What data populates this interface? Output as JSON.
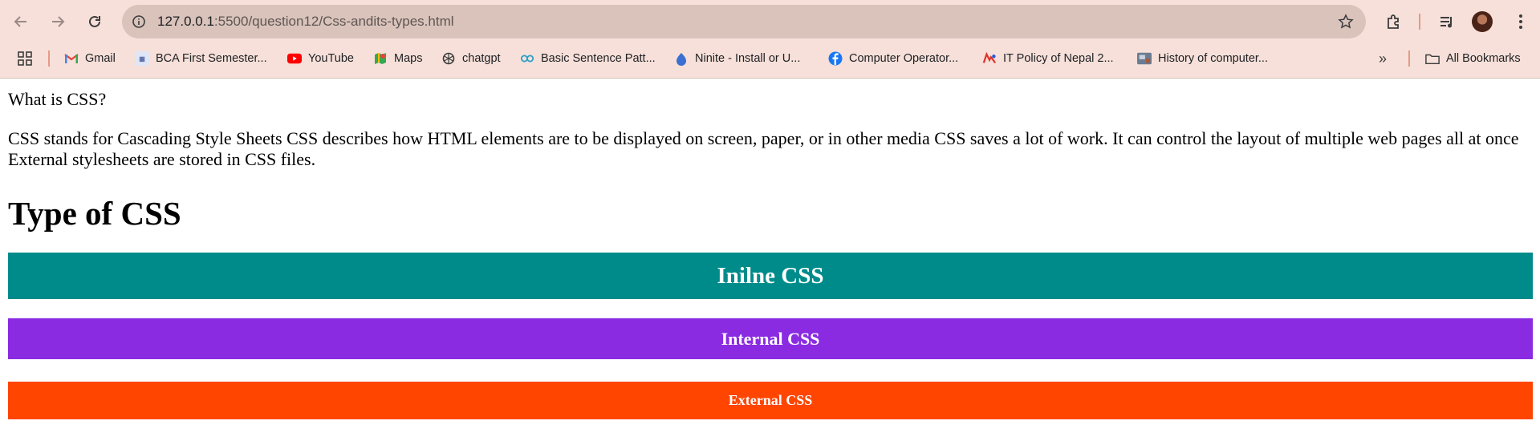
{
  "browser": {
    "url_host": "127.0.0.1",
    "url_path": ":5500/question12/Css-andits-types.html",
    "bookmarks": [
      {
        "label": "Gmail",
        "icon": "gmail-icon"
      },
      {
        "label": "BCA First Semester...",
        "icon": "bca-icon"
      },
      {
        "label": "YouTube",
        "icon": "youtube-icon"
      },
      {
        "label": "Maps",
        "icon": "maps-icon"
      },
      {
        "label": "chatgpt",
        "icon": "chatgpt-icon"
      },
      {
        "label": "Basic Sentence Patt...",
        "icon": "infinity-icon"
      },
      {
        "label": "Ninite - Install or U...",
        "icon": "ninite-icon"
      },
      {
        "label": "Computer Operator...",
        "icon": "facebook-icon"
      },
      {
        "label": "IT Policy of Nepal 2...",
        "icon": "itpolicy-icon"
      },
      {
        "label": "History of computer...",
        "icon": "history-icon"
      }
    ],
    "all_bookmarks_label": "All Bookmarks"
  },
  "page": {
    "question": "What is CSS?",
    "paragraph": "CSS stands for Cascading Style Sheets CSS describes how HTML elements are to be displayed on screen, paper, or in other media CSS saves a lot of work. It can control the layout of multiple web pages all at once External stylesheets are stored in CSS files.",
    "heading": "Type of CSS",
    "types": {
      "inline": "Inilne CSS",
      "internal": "Internal CSS",
      "external": "External CSS"
    }
  },
  "colors": {
    "inline_bg": "#008b8b",
    "internal_bg": "#8a2be2",
    "external_bg": "#ff4500",
    "chrome_bg": "#f6e0d9"
  }
}
